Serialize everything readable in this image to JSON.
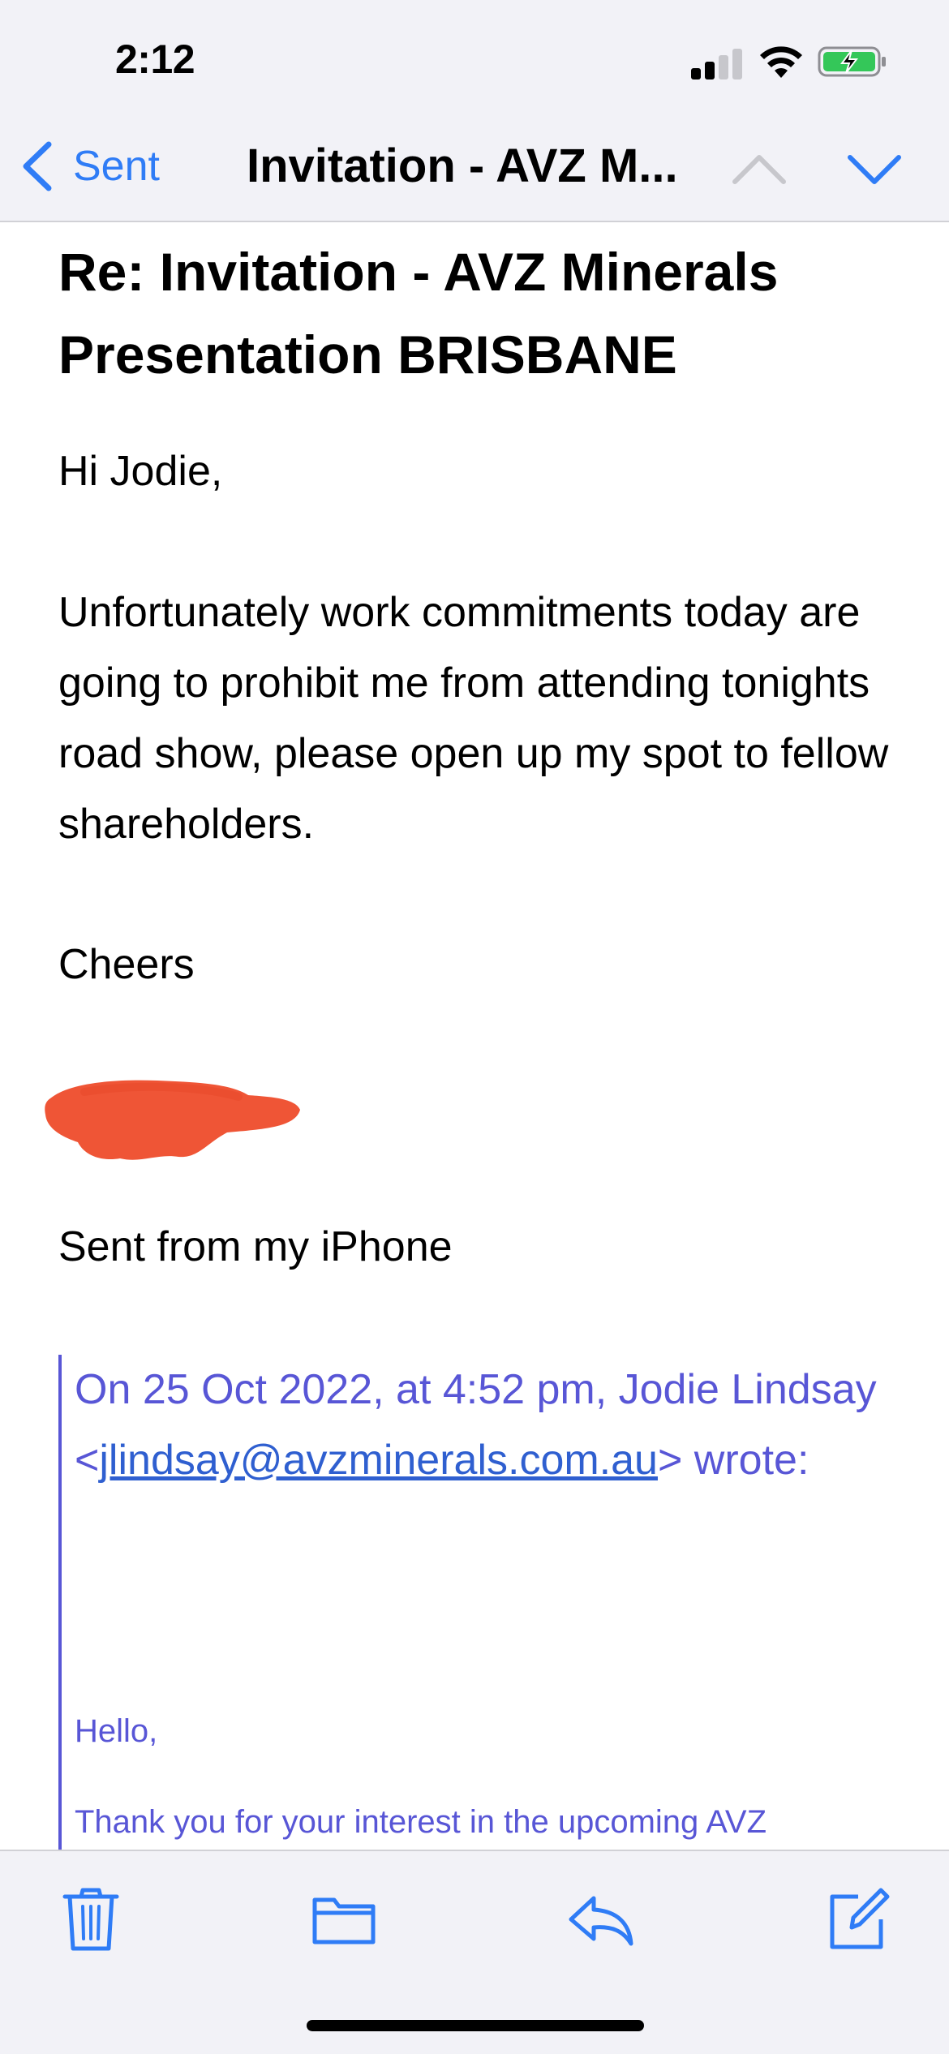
{
  "status_bar": {
    "time": "2:12"
  },
  "nav": {
    "back_label": "Sent",
    "title": "Invitation - AVZ M..."
  },
  "email": {
    "subject": "Re: Invitation - AVZ Minerals Presentation BRISBANE",
    "greeting": "Hi Jodie,",
    "paragraph": "Unfortunately work commitments today are going to prohibit me from attending tonights road show, please open up my spot to fellow shareholders.",
    "signoff": "Cheers",
    "signature": "Sent from my iPhone"
  },
  "quoted": {
    "header_prefix": "On 25 Oct 2022, at 4:52 pm, Jodie Lindsay <",
    "email_link": "jlindsay@avzminerals.com.au",
    "header_suffix": "> wrote:",
    "hello": "Hello,",
    "first_line": "Thank you for your interest in the upcoming AVZ"
  },
  "toolbar": {
    "icons": [
      "trash-icon",
      "folder-icon",
      "reply-icon",
      "compose-icon"
    ]
  },
  "colors": {
    "accent": "#2f7cf6",
    "quote": "#5856d6",
    "redaction": "#ef5536",
    "bar_background": "#f2f2f7"
  }
}
